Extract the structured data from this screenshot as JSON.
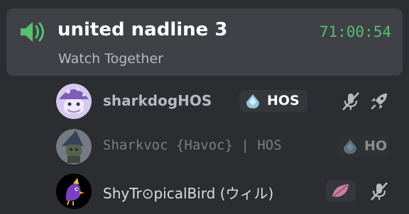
{
  "channel": {
    "name": "united nadline 3",
    "timer": "71:00:54",
    "activity": "Watch Together",
    "icon": "speaker-icon"
  },
  "members": [
    {
      "name": "sharkdogHOS",
      "tag": "HOS",
      "tag_icon": "diamond-drop-icon",
      "status_icons": [
        "muted-mic-icon",
        "rocket-icon"
      ]
    },
    {
      "name": "Sharkvoc {Havoc} | HOS",
      "tag": "HO",
      "tag_icon": "diamond-drop-icon",
      "status_icons": []
    },
    {
      "name": "ShyTr⊙picalBird (ウィル)",
      "tag": "",
      "tag_icon": "leaf-icon",
      "status_icons": [
        "muted-mic-icon"
      ]
    }
  ],
  "colors": {
    "background": "#2b2d31",
    "channel_bg": "#3f4147",
    "accent_green": "#57c06f",
    "muted_text": "#b5bac1"
  }
}
